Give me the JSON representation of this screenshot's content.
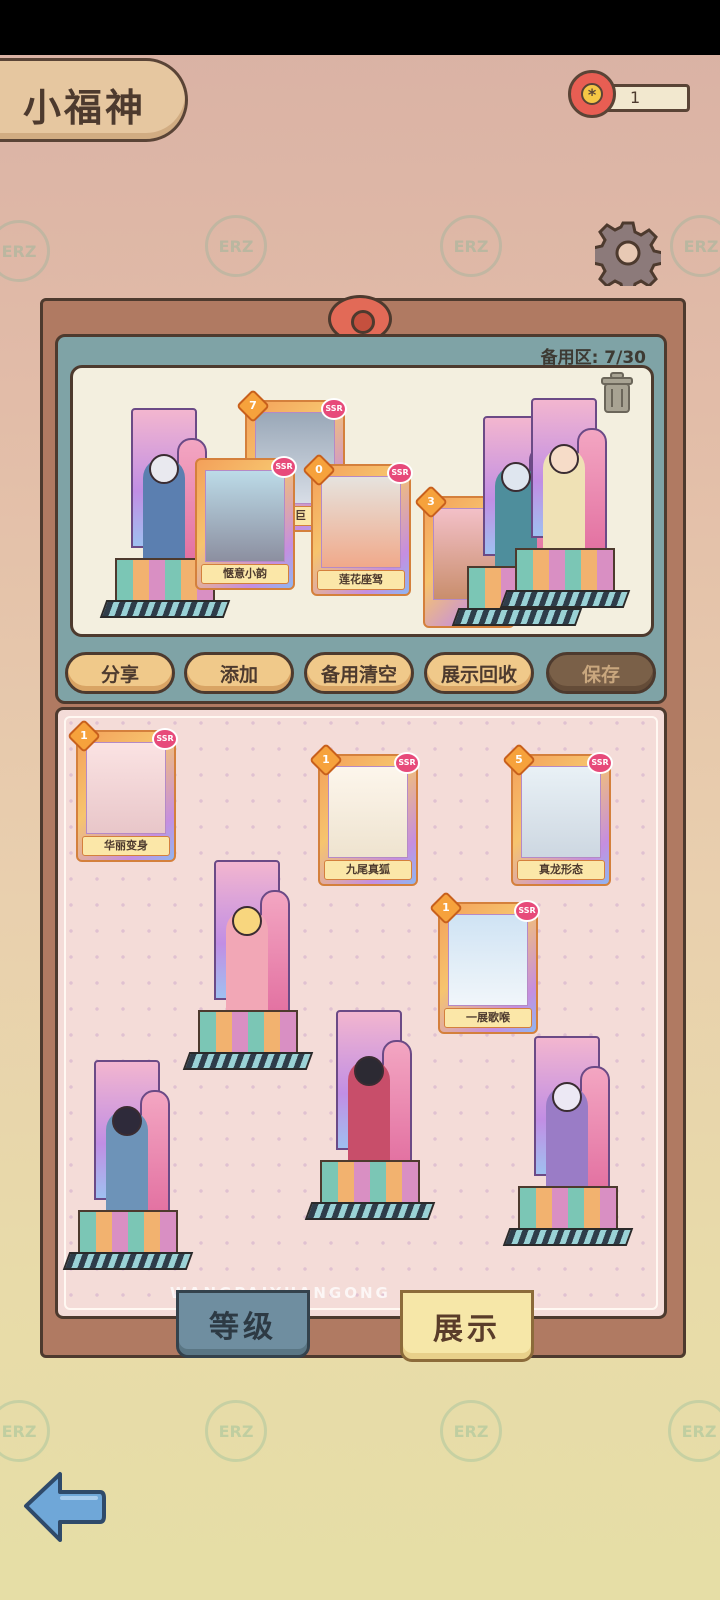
{
  "header": {
    "title": "小福神"
  },
  "currency": {
    "value": "1",
    "icon": "flower-icon"
  },
  "reserve": {
    "count_label": "备用区: 7/30",
    "cards": [
      {
        "name": "惬意小韵",
        "level": "",
        "rarity": "SSR"
      },
      {
        "name": "莲花座驾",
        "level": "0",
        "rarity": "SSR"
      },
      {
        "name": "涌巨",
        "level": "7",
        "rarity": "SSR"
      },
      {
        "name": "",
        "level": "3",
        "rarity": ""
      }
    ]
  },
  "actions": {
    "share": "分享",
    "add": "添加",
    "clear_reserve": "备用清空",
    "recall_display": "展示回收",
    "save": "保存"
  },
  "display": {
    "cards": [
      {
        "name": "华丽变身",
        "level": "1",
        "rarity": "SSR"
      },
      {
        "name": "九尾真狐",
        "level": "1",
        "rarity": "SSR"
      },
      {
        "name": "真龙形态",
        "level": "5",
        "rarity": "SSR"
      },
      {
        "name": "一展歌喉",
        "level": "1",
        "rarity": "SSR"
      }
    ],
    "watermark": "WANGPAIYUANGONG"
  },
  "tabs": {
    "level": "等级",
    "display": "展示"
  },
  "colors": {
    "accent_button": "#f0c98a",
    "panel_teal": "#7fa3a6",
    "board_brown": "#b07a62"
  }
}
